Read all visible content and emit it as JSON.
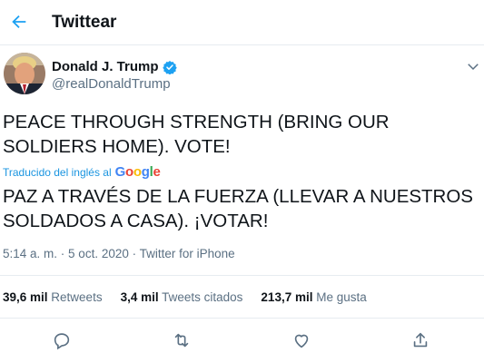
{
  "header": {
    "title": "Twittear",
    "back_icon": "arrow-left-icon"
  },
  "author": {
    "name": "Donald J. Trump",
    "handle": "@realDonaldTrump",
    "verified_icon": "verified-badge-icon",
    "menu_icon": "chevron-down-icon"
  },
  "tweet": {
    "text": "PEACE THROUGH STRENGTH (BRING OUR SOLDIERS HOME). VOTE!",
    "translated_by_label": "Traducido del inglés al",
    "translation_provider": "Google",
    "translation": "PAZ A TRAVÉS DE LA FUERZA (LLEVAR A NUESTROS SOLDADOS A CASA). ¡VOTAR!",
    "time": "5:14 a. m.",
    "date": "5 oct. 2020",
    "source": "Twitter for iPhone"
  },
  "stats": {
    "retweets_count": "39,6 mil",
    "retweets_label": "Retweets",
    "quotes_count": "3,4 mil",
    "quotes_label": "Tweets citados",
    "likes_count": "213,7 mil",
    "likes_label": "Me gusta"
  },
  "actions": [
    "reply-icon",
    "retweet-icon",
    "like-icon",
    "share-icon"
  ],
  "colors": {
    "accent": "#1da1f2",
    "secondary_text": "#5b7083",
    "border": "#e6ecf0"
  }
}
